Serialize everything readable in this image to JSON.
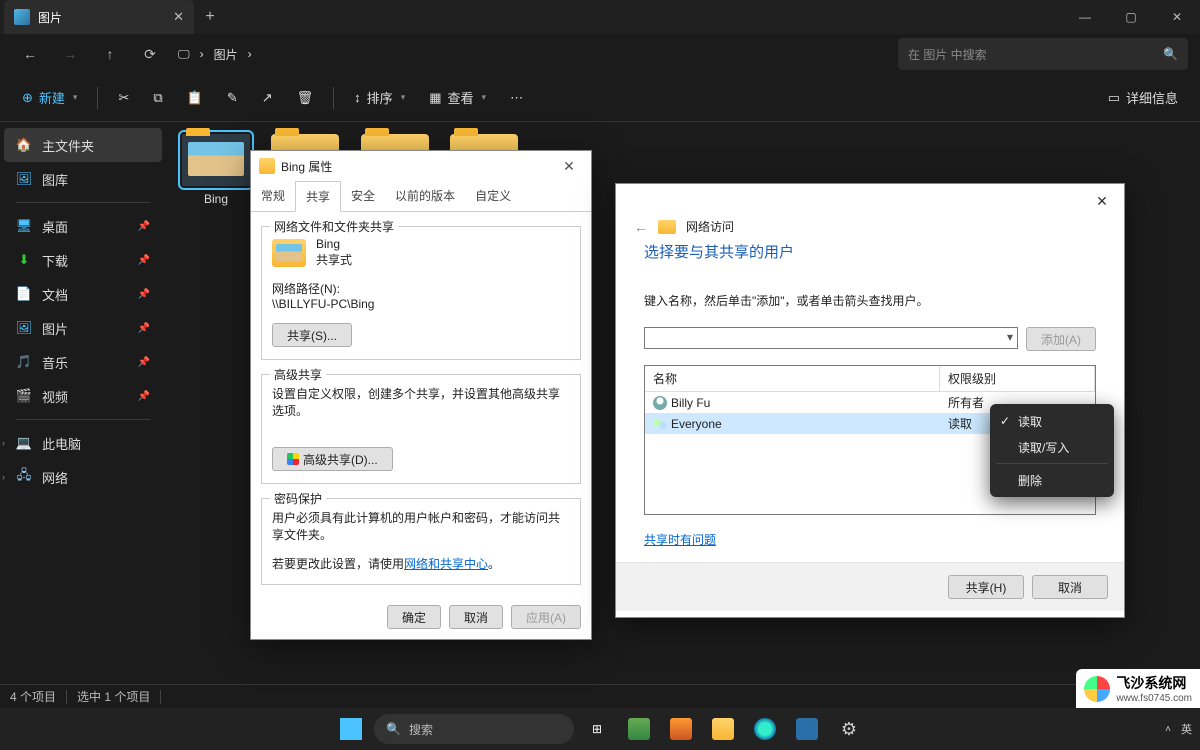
{
  "titlebar": {
    "tab_label": "图片"
  },
  "nav": {
    "breadcrumb": [
      "图片"
    ],
    "search_placeholder": "在 图片 中搜索"
  },
  "toolbar": {
    "new": "新建",
    "sort": "排序",
    "view": "查看",
    "details": "详细信息"
  },
  "sidebar": {
    "home": "主文件夹",
    "gallery": "图库",
    "desktop": "桌面",
    "downloads": "下载",
    "documents": "文档",
    "pictures": "图片",
    "music": "音乐",
    "videos": "视频",
    "thispc": "此电脑",
    "network": "网络"
  },
  "folders": {
    "bing": "Bing"
  },
  "status": {
    "items": "4 个项目",
    "selected": "选中 1 个项目"
  },
  "props": {
    "title": "Bing 属性",
    "tabs": {
      "general": "常规",
      "sharing": "共享",
      "security": "安全",
      "prev": "以前的版本",
      "custom": "自定义"
    },
    "grp1_title": "网络文件和文件夹共享",
    "folder_name": "Bing",
    "shared_state": "共享式",
    "netpath_label": "网络路径(N):",
    "netpath": "\\\\BILLYFU-PC\\Bing",
    "share_btn": "共享(S)...",
    "grp2_title": "高级共享",
    "grp2_text": "设置自定义权限，创建多个共享，并设置其他高级共享选项。",
    "adv_btn": "高级共享(D)...",
    "grp3_title": "密码保护",
    "grp3_line1": "用户必须具有此计算机的用户帐户和密码，才能访问共享文件夹。",
    "grp3_line2a": "若要更改此设置，请使用",
    "grp3_link": "网络和共享中心",
    "ok": "确定",
    "cancel": "取消",
    "apply": "应用(A)"
  },
  "net": {
    "crumb": "网络访问",
    "heading": "选择要与其共享的用户",
    "sub": "键入名称，然后单击\"添加\"，或者单击箭头查找用户。",
    "add_btn": "添加(A)",
    "col_name": "名称",
    "col_perm": "权限级别",
    "rows": [
      {
        "user": "Billy Fu",
        "perm": "所有者"
      },
      {
        "user": "Everyone",
        "perm": "读取"
      }
    ],
    "help": "共享时有问题",
    "share_btn": "共享(H)",
    "cancel_btn": "取消"
  },
  "ctx": {
    "read": "读取",
    "readwrite": "读取/写入",
    "remove": "删除"
  },
  "taskbar": {
    "search": "搜索",
    "lang": "英"
  },
  "watermark": {
    "line1": "飞沙系统网",
    "line2": "www.fs0745.com"
  }
}
